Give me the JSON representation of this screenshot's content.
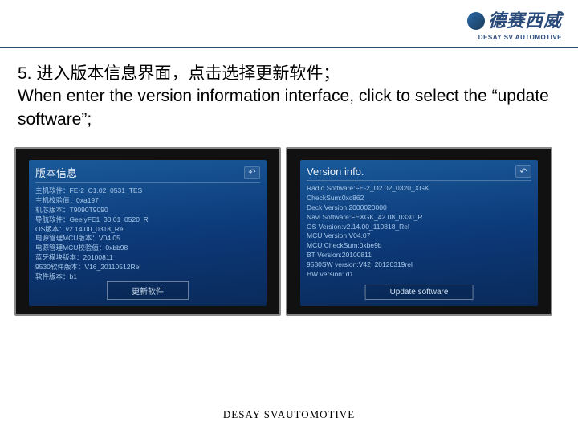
{
  "header": {
    "logo_cn": "德赛西威",
    "logo_en": "DESAY SV AUTOMOTIVE"
  },
  "instruction": {
    "cn": "5. 进入版本信息界面，点击选择更新软件；",
    "en": "When enter the version information interface, click to select the “update software”;"
  },
  "screen_left": {
    "title": "版本信息",
    "lines": [
      "主机软件：FE-2_C1.02_0531_TES",
      "主机校验值：0xa197",
      "机芯版本：T9090T9090",
      "导航软件：GeelyFE1_30.01_0520_R",
      "OS版本：v2.14.00_0318_Rel",
      "电源管理MCU版本：V04.05",
      "电源管理MCU校验值：0xbb98",
      "蓝牙模块版本：20100811",
      "9530软件版本：V16_20110512Rel",
      "软件版本：b1"
    ],
    "button": "更新软件"
  },
  "screen_right": {
    "title": "Version info.",
    "lines": [
      "Radio Software:FE-2_D2.02_0320_XGK",
      "CheckSum:0xc862",
      "Deck Version:2000020000",
      "Navi Software:FEXGK_42.08_0330_R",
      "OS Version:v2.14.00_110818_Rel",
      "MCU Version:V04.07",
      "MCU CheckSum:0xbe9b",
      "BT Version:20100811",
      "9530SW version:V42_20120319rel",
      "HW version: d1"
    ],
    "button": "Update software"
  },
  "footer": "DESAY SVAUTOMOTIVE"
}
